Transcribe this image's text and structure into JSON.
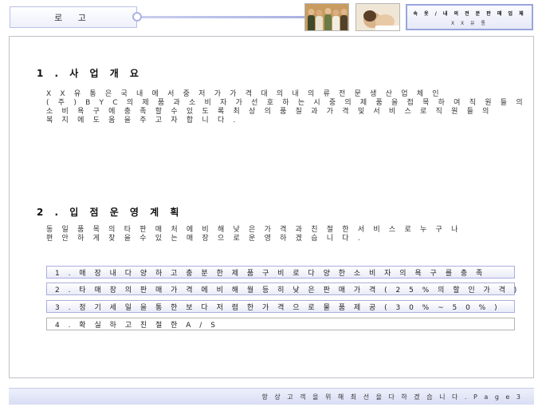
{
  "header": {
    "logo": "로 고",
    "title_main": "속 옷 / 내 의  전 문 판 매  업 체",
    "title_sub": "X X 유 통"
  },
  "section1": {
    "heading": "1 . 사 업 개 요",
    "lines": [
      "X X 유 통 은  국 내 에 서  중 저 가  가 격 대 의  내 의 류  전 문  생 산 업 체 인",
      "( 주 ) B Y C 의  제 품 과  소 비 자 가  선 호 하 는  시 중 의  제 품 을  접 목 하 여  직 원 들 의",
      "소 비 욕 구 에  충 족 할  수  있 도 록  최 상 의  품 질 과  가 격  및  서 비 스 로  직 원 들 의",
      "복 지 에  도 움 을  주 고 자  합 니 다 ."
    ]
  },
  "section2": {
    "heading": "2 .  입 점  운 영 계 획",
    "lines": [
      "동 일 품 목 의  타  판 매 처 에  비 해  낮 은  가 격 과  친 절 한  서 비 스 로  누 구 나",
      "편 안 하 게  찾 을  수  있 는  매 장 으 로  운 영 하 겠 습 니 다 ."
    ],
    "items": [
      "1 .  매 장  내  다 양 하 고  충 분 한  제 품  구 비 로  다 양 한  소 비 자 의  욕 구 를  충 족",
      "2 .  타  매 장 의  판 매  가 격 에  비 해  월 등 히  낮 은  판 매 가 격 ( 2 5 %  의  할 인 가 격 )",
      "3 .  정 기 세 일 을  통 한  보 다  저 렴 한  가 격 으 로  물 품  제 공 ( 3 0 %  ~  5 0 % )",
      "4 .  확 실 하 고  친 절 한  A / S"
    ]
  },
  "footer": {
    "text": "항 상  고 객 을  위 해  최 선 을  다 하 겠 습 니 다 .  P a g e  3"
  },
  "colors": {
    "accent_border": "#a9afdb",
    "header_gradient": "#e6e9f8"
  }
}
